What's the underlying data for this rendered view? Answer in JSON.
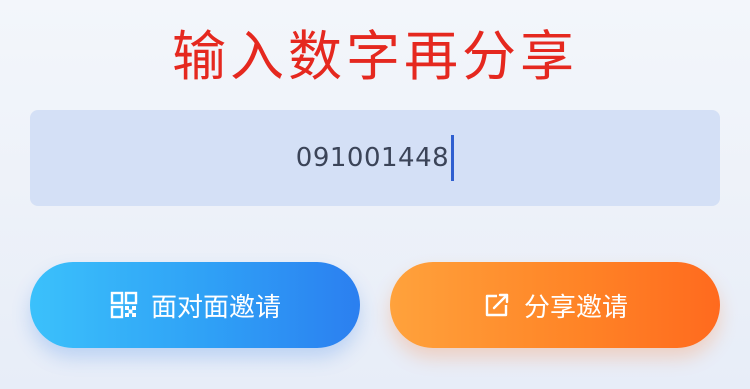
{
  "title": "输入数字再分享",
  "input": {
    "value": "091001448"
  },
  "buttons": {
    "face_to_face_label": "面对面邀请",
    "face_to_face_icon": "qr-code-icon",
    "share_label": "分享邀请",
    "share_icon": "share-icon"
  },
  "colors": {
    "title": "#e5281f",
    "input_bg": "#d4e0f6",
    "blue_button": "#2fa0f6",
    "orange_button": "#ff8527"
  }
}
